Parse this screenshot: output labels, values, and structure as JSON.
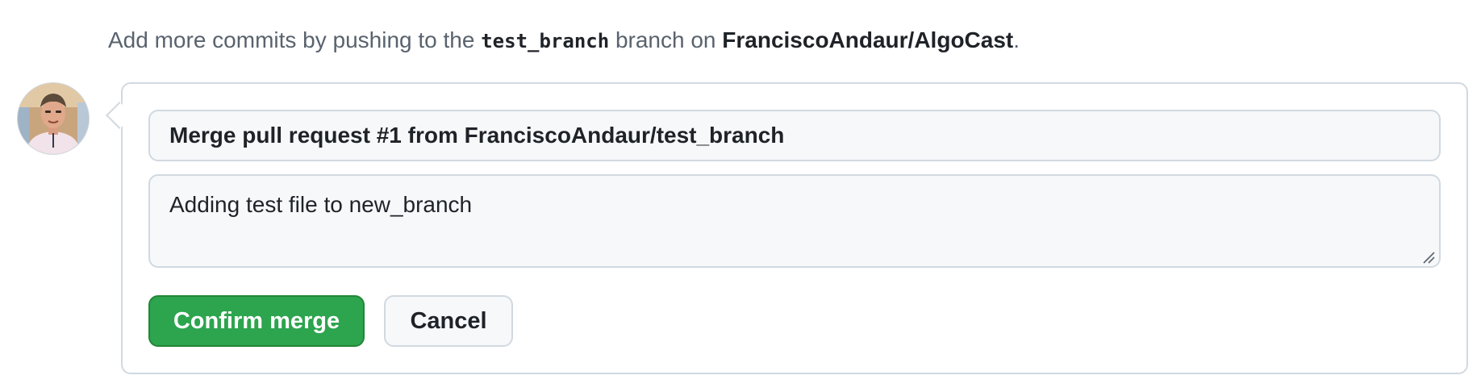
{
  "hint": {
    "prefix": "Add more commits by pushing to the ",
    "branch": "test_branch",
    "middle": " branch on ",
    "repository": "FranciscoAndaur/AlgoCast",
    "suffix": "."
  },
  "author": {
    "avatar_icon": "user-avatar"
  },
  "merge_form": {
    "commit_title": "Merge pull request #1 from FranciscoAndaur/test_branch",
    "commit_body": "Adding test file to new_branch",
    "confirm_label": "Confirm merge",
    "cancel_label": "Cancel"
  },
  "colors": {
    "confirm_button": "#2da44e",
    "border": "#d1d9e0",
    "input_background": "#f6f8fa",
    "muted_text": "#59636e"
  }
}
